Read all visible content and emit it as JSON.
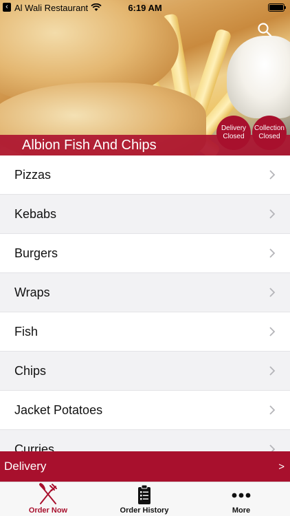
{
  "status_bar": {
    "back_app": "Al Wali Restaurant",
    "time": "6:19 AM",
    "back_icon": "back-arrow-icon",
    "wifi_icon": "wifi-icon",
    "battery_icon": "battery-icon",
    "battery_level": 1.0
  },
  "header": {
    "restaurant_name": "Albion Fish And Chips",
    "search_icon": "search-icon",
    "delivery_status": {
      "line1": "Delivery",
      "line2": "Closed"
    },
    "collection_status": {
      "line1": "Collection",
      "line2": "Closed"
    }
  },
  "categories": [
    {
      "label": "Pizzas"
    },
    {
      "label": "Kebabs"
    },
    {
      "label": "Burgers"
    },
    {
      "label": "Wraps"
    },
    {
      "label": "Fish"
    },
    {
      "label": "Chips"
    },
    {
      "label": "Jacket Potatoes"
    },
    {
      "label": "Curries"
    }
  ],
  "delivery_bar": {
    "label": "Delivery",
    "arrow": ">"
  },
  "tabs": [
    {
      "label": "Order Now",
      "icon": "fork-knife-icon",
      "active": true
    },
    {
      "label": "Order History",
      "icon": "clipboard-list-icon",
      "active": false
    },
    {
      "label": "More",
      "icon": "more-dots-icon",
      "active": false
    }
  ],
  "colors": {
    "brand_red": "#a8102d",
    "active_tab": "#a8102d"
  }
}
